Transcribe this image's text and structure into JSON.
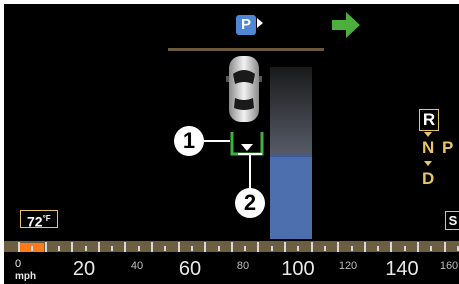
{
  "indicators": {
    "park_label": "P",
    "park_color": "#4f86d6",
    "direction_arrow_color": "#4cae3c"
  },
  "callouts": {
    "one": "1",
    "two": "2"
  },
  "gear_selector": {
    "reverse": "R",
    "neutral": "N",
    "park": "P",
    "drive": "D"
  },
  "climate": {
    "temperature_value": "72",
    "temperature_unit": "°F"
  },
  "mode_badge": "S",
  "speedometer": {
    "unit": "mph",
    "zero_label": "0",
    "current_speed_fraction": 0.06,
    "major_labels": [
      "20",
      "60",
      "100",
      "140"
    ],
    "minor_labels": [
      "40",
      "80",
      "120",
      "160"
    ],
    "accent_color": "#ff7a1a"
  }
}
